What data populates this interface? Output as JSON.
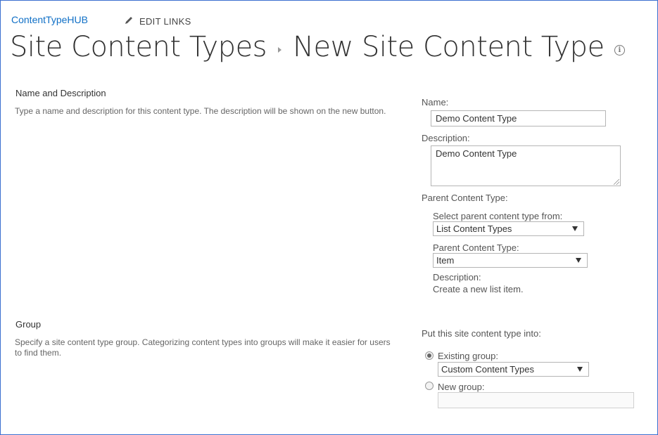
{
  "header": {
    "site_name": "ContentTypeHUB",
    "edit_links_label": "EDIT LINKS",
    "breadcrumb_parent": "Site Content Types",
    "page_title": "New Site Content Type",
    "edit_icon": "pencil-icon",
    "info_icon": "info-icon"
  },
  "name_section": {
    "title": "Name and Description",
    "description": "Type a name and description for this content type. The description will be shown on the new button.",
    "name_label": "Name:",
    "name_value": "Demo Content Type",
    "description_label": "Description:",
    "description_value": "Demo Content Type",
    "parent_label": "Parent Content Type:",
    "select_from_label": "Select parent content type from:",
    "select_from_value": "List Content Types",
    "parent_type_label": "Parent Content Type:",
    "parent_type_value": "Item",
    "parent_desc_label": "Description:",
    "parent_desc_value": "Create a new list item."
  },
  "group_section": {
    "title": "Group",
    "description": "Specify a site content type group. Categorizing content types into groups will make it easier for users to find them.",
    "put_into_label": "Put this site content type into:",
    "existing_group_label": "Existing group:",
    "existing_group_value": "Custom Content Types",
    "existing_group_selected": true,
    "new_group_label": "New group:",
    "new_group_value": ""
  }
}
